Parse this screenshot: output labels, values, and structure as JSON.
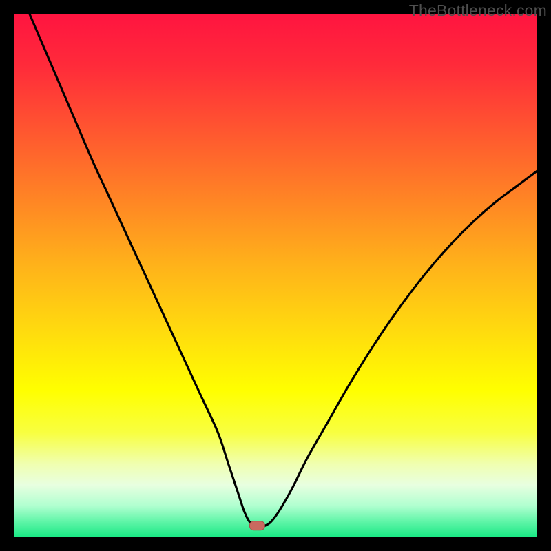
{
  "watermark": "TheBottleneck.com",
  "colors": {
    "background": "#000000",
    "gradient_stops": [
      {
        "offset": 0.0,
        "color": "#ff1440"
      },
      {
        "offset": 0.1,
        "color": "#ff2b3a"
      },
      {
        "offset": 0.22,
        "color": "#ff5530"
      },
      {
        "offset": 0.35,
        "color": "#ff8325"
      },
      {
        "offset": 0.48,
        "color": "#ffb21a"
      },
      {
        "offset": 0.6,
        "color": "#ffd90f"
      },
      {
        "offset": 0.72,
        "color": "#ffff00"
      },
      {
        "offset": 0.8,
        "color": "#f8ff40"
      },
      {
        "offset": 0.86,
        "color": "#f0ffb0"
      },
      {
        "offset": 0.9,
        "color": "#e8ffe0"
      },
      {
        "offset": 0.94,
        "color": "#b0ffd0"
      },
      {
        "offset": 0.97,
        "color": "#60f5a8"
      },
      {
        "offset": 1.0,
        "color": "#18e884"
      }
    ],
    "curve": "#000000",
    "marker_fill": "#c96a60",
    "marker_stroke": "#a84f48"
  },
  "chart_data": {
    "type": "line",
    "title": "",
    "xlabel": "",
    "ylabel": "",
    "xlim": [
      0,
      100
    ],
    "ylim": [
      0,
      100
    ],
    "grid": false,
    "x": [
      3,
      6,
      9,
      12,
      15,
      18,
      21,
      24,
      27,
      30,
      33,
      36,
      39,
      41,
      43,
      44,
      45,
      46,
      48,
      50,
      53,
      56,
      60,
      64,
      68,
      72,
      76,
      80,
      84,
      88,
      92,
      96,
      100
    ],
    "values": [
      100,
      93,
      86,
      79,
      72,
      65.5,
      59,
      52.5,
      46,
      39.5,
      33,
      26.5,
      20,
      14,
      8,
      5,
      3,
      2.2,
      2.2,
      4,
      9,
      15,
      22,
      29,
      35.5,
      41.5,
      47,
      52,
      56.5,
      60.5,
      64,
      67,
      70
    ],
    "marker": {
      "x": 46.5,
      "y": 2.2
    }
  }
}
